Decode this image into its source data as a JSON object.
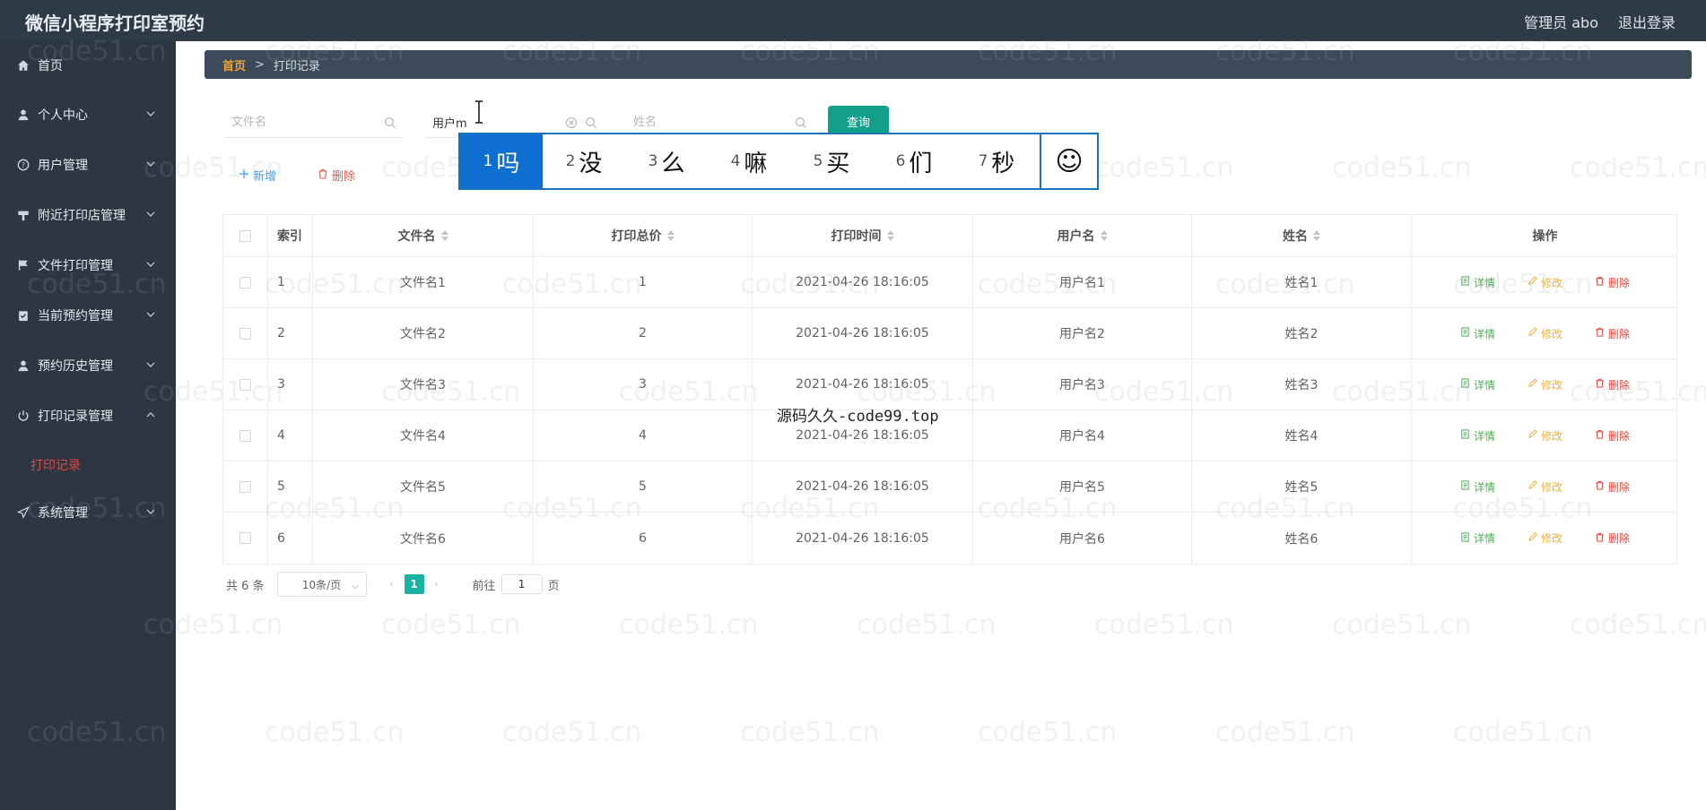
{
  "header": {
    "title": "微信小程序打印室预约",
    "user_label": "管理员 abo",
    "logout_label": "退出登录"
  },
  "sidebar": {
    "items": [
      {
        "label": "首页",
        "icon": "home-icon"
      },
      {
        "label": "个人中心",
        "icon": "user-icon"
      },
      {
        "label": "用户管理",
        "icon": "help-circle-icon"
      },
      {
        "label": "附近打印店管理",
        "icon": "shop-icon"
      },
      {
        "label": "文件打印管理",
        "icon": "flag-icon"
      },
      {
        "label": "当前预约管理",
        "icon": "clipboard-check-icon"
      },
      {
        "label": "预约历史管理",
        "icon": "user-history-icon"
      },
      {
        "label": "打印记录管理",
        "icon": "power-icon"
      },
      {
        "label": "系统管理",
        "icon": "send-icon"
      }
    ],
    "subitem_active": "打印记录"
  },
  "breadcrumb": {
    "home": "首页",
    "separator": ">",
    "current": "打印记录"
  },
  "search": {
    "filename_placeholder": "文件名",
    "username_value": "用户m",
    "name_placeholder": "姓名",
    "query_label": "查询"
  },
  "toolbar": {
    "add_label": "新增",
    "delete_label": "删除"
  },
  "ime": {
    "candidates": [
      {
        "n": "1",
        "ch": "吗"
      },
      {
        "n": "2",
        "ch": "没"
      },
      {
        "n": "3",
        "ch": "么"
      },
      {
        "n": "4",
        "ch": "嘛"
      },
      {
        "n": "5",
        "ch": "买"
      },
      {
        "n": "6",
        "ch": "们"
      },
      {
        "n": "7",
        "ch": "秒"
      }
    ],
    "emoji": "☺"
  },
  "table": {
    "headers": [
      "索引",
      "文件名",
      "打印总价",
      "打印时间",
      "用户名",
      "姓名",
      "操作"
    ],
    "rows": [
      {
        "idx": "1",
        "file": "文件名1",
        "price": "1",
        "time": "2021-04-26 18:16:05",
        "user": "用户名1",
        "name": "姓名1"
      },
      {
        "idx": "2",
        "file": "文件名2",
        "price": "2",
        "time": "2021-04-26 18:16:05",
        "user": "用户名2",
        "name": "姓名2"
      },
      {
        "idx": "3",
        "file": "文件名3",
        "price": "3",
        "time": "2021-04-26 18:16:05",
        "user": "用户名3",
        "name": "姓名3"
      },
      {
        "idx": "4",
        "file": "文件名4",
        "price": "4",
        "time": "2021-04-26 18:16:05",
        "user": "用户名4",
        "name": "姓名4"
      },
      {
        "idx": "5",
        "file": "文件名5",
        "price": "5",
        "time": "2021-04-26 18:16:05",
        "user": "用户名5",
        "name": "姓名5"
      },
      {
        "idx": "6",
        "file": "文件名6",
        "price": "6",
        "time": "2021-04-26 18:16:05",
        "user": "用户名6",
        "name": "姓名6"
      }
    ],
    "ops": {
      "detail": "详情",
      "edit": "修改",
      "delete": "删除"
    }
  },
  "pagination": {
    "total": "共 6 条",
    "page_size": "10条/页",
    "current_page": "1",
    "goto_label": "前往",
    "goto_value": "1",
    "page_suffix": "页"
  },
  "watermark": {
    "center_text": "源码久久-code99.top",
    "tile_text": "code51.cn"
  }
}
